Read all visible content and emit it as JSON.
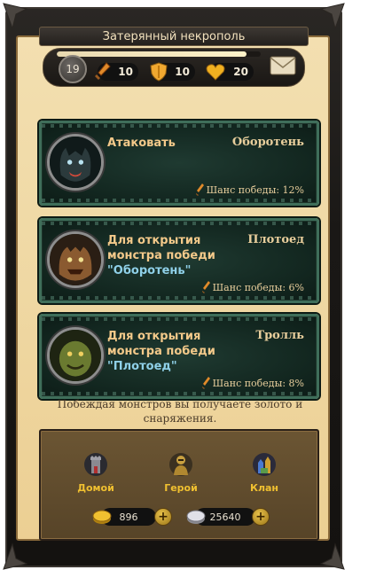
{
  "header": {
    "title": "Затерянный некрополь"
  },
  "stats": {
    "level": "19",
    "xp_progress": 0.93,
    "energy": "10",
    "shield": "10",
    "health": "20",
    "icons": {
      "energy": "sword-icon",
      "shield": "shield-icon",
      "health": "heart-icon",
      "mail": "envelope-icon"
    }
  },
  "monsters": [
    {
      "action_label": "Атаковать",
      "locked_text": "",
      "required_monster": "",
      "name": "Оборотень",
      "chance_label": "Шанс победы: 12%",
      "portrait": "werewolf-portrait"
    },
    {
      "action_label": "",
      "locked_text": "Для открытия монстра победи",
      "required_monster": "\"Оборотень\"",
      "name": "Плотоед",
      "chance_label": "Шанс победы: 6%",
      "portrait": "ghoul-portrait"
    },
    {
      "action_label": "",
      "locked_text": "Для открытия монстра победи",
      "required_monster": "\"Плотоед\"",
      "name": "Тролль",
      "chance_label": "Шанс победы: 8%",
      "portrait": "troll-portrait"
    }
  ],
  "hint": "Побеждая монстров вы получаете золото и снаряжения.",
  "nav": [
    {
      "label": "Домой",
      "icon": "tower-icon"
    },
    {
      "label": "Герой",
      "icon": "knight-icon"
    },
    {
      "label": "Клан",
      "icon": "castle-icon"
    }
  ],
  "currency": {
    "gold": "896",
    "silver": "25640",
    "plus_label": "+"
  },
  "colors": {
    "accent_gold": "#f0c030",
    "card_border": "#3f6e5a",
    "parchment": "#efd8a3",
    "link_blue": "#8fd0e8"
  }
}
